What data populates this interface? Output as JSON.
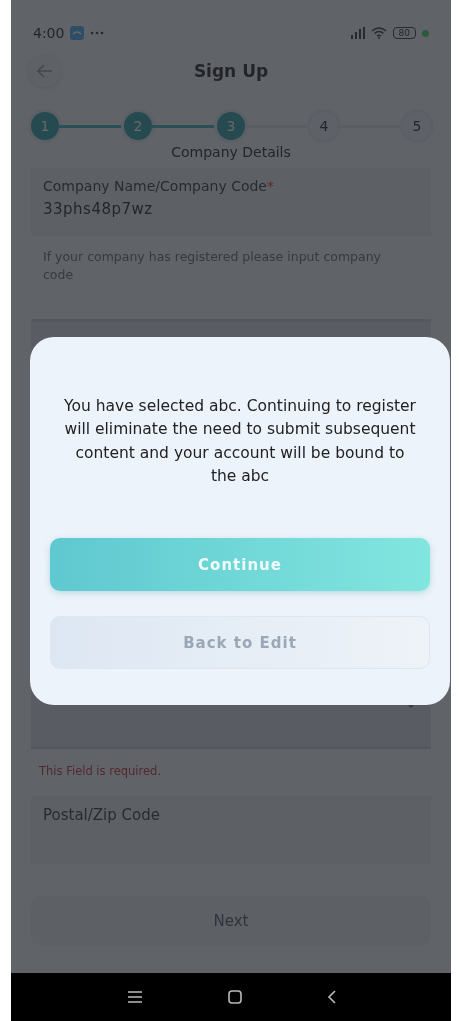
{
  "status_bar": {
    "time": "4:00",
    "battery": "80"
  },
  "header": {
    "title": "Sign Up"
  },
  "stepper": {
    "steps": [
      {
        "label": "1",
        "completed": true
      },
      {
        "label": "2",
        "completed": true
      },
      {
        "label": "3",
        "completed": true
      },
      {
        "label": "4",
        "completed": false
      },
      {
        "label": "5",
        "completed": false
      }
    ],
    "current_title": "Company Details"
  },
  "form": {
    "company_field": {
      "label": "Company Name/Company Code",
      "required_mark": "*",
      "value": "33phs48p7wz"
    },
    "company_hint": "If your company has registered please input company code",
    "error": "This Field is required.",
    "postal_field": {
      "label": "Postal/Zip Code"
    },
    "next_button": "Next"
  },
  "dialog": {
    "message": "You have selected abc. Continuing to register will eliminate the need to submit subsequent content and your account will be bound to the abc",
    "buttons": [
      {
        "label": "Continue",
        "kind": "primary"
      },
      {
        "label": "Back to Edit",
        "kind": "secondary"
      }
    ]
  }
}
